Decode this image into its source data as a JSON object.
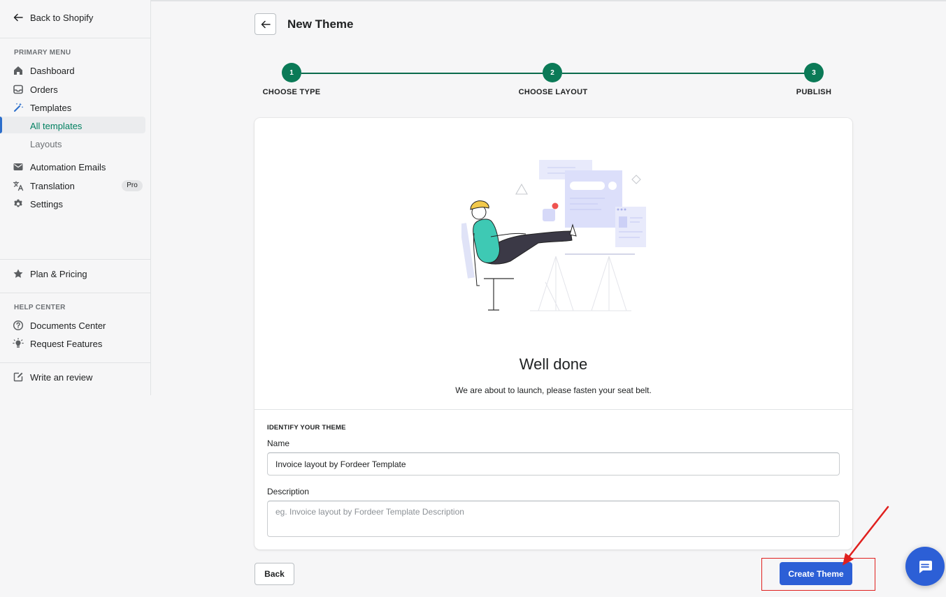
{
  "sidebar": {
    "back_label": "Back to Shopify",
    "primary_heading": "PRIMARY MENU",
    "items": {
      "dashboard": "Dashboard",
      "orders": "Orders",
      "templates": "Templates",
      "all_templates": "All templates",
      "layouts": "Layouts",
      "automation_emails": "Automation Emails",
      "translation": "Translation",
      "translation_badge": "Pro",
      "settings": "Settings",
      "plan_pricing": "Plan & Pricing"
    },
    "help_heading": "HELP CENTER",
    "help_items": {
      "documents": "Documents Center",
      "request_features": "Request Features",
      "write_review": "Write an review"
    }
  },
  "header": {
    "title": "New Theme"
  },
  "stepper": {
    "steps": [
      {
        "number": "1",
        "label": "CHOOSE TYPE"
      },
      {
        "number": "2",
        "label": "CHOOSE LAYOUT"
      },
      {
        "number": "3",
        "label": "PUBLISH"
      }
    ],
    "active_color": "#0b7a57"
  },
  "card": {
    "heading": "Well done",
    "subtext": "We are about to launch, please fasten your seat belt.",
    "section_title": "IDENTIFY YOUR THEME",
    "name_label": "Name",
    "name_value": "Invoice layout by Fordeer Template",
    "description_label": "Description",
    "description_placeholder": "eg. Invoice layout by Fordeer Template Description"
  },
  "footer": {
    "back_label": "Back",
    "create_label": "Create Theme"
  },
  "colors": {
    "primary": "#2c5fd6",
    "success": "#0b7a57",
    "annotation": "#e0201e"
  },
  "icons": [
    "arrow-left-icon",
    "home-icon",
    "inbox-icon",
    "magic-wand-icon",
    "mail-icon",
    "translate-icon",
    "gear-icon",
    "star-icon",
    "help-circle-icon",
    "lightbulb-icon",
    "edit-icon",
    "chat-icon"
  ]
}
